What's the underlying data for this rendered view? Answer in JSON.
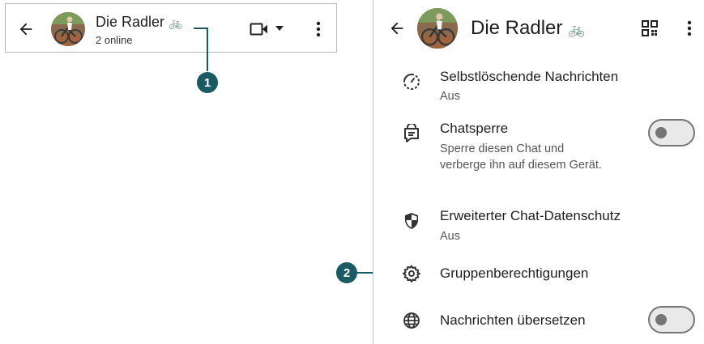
{
  "left_header": {
    "title": "Die Radler",
    "title_emoji": "🚲",
    "subtitle": "2 online",
    "icons": [
      "back-arrow-icon",
      "video-call-icon",
      "chevron-down-icon",
      "more-vertical-icon"
    ]
  },
  "right_panel": {
    "header": {
      "title": "Die Radler",
      "title_emoji": "🚲",
      "icons": [
        "back-arrow-icon",
        "qr-code-icon",
        "more-vertical-icon"
      ]
    },
    "settings": [
      {
        "icon": "disappearing-timer-icon",
        "title": "Selbstlöschende Nachrichten",
        "subtitle": "Aus"
      },
      {
        "icon": "chat-lock-icon",
        "title": "Chatsperre",
        "subtitle": "Sperre diesen Chat und verberge ihn auf diesem Gerät.",
        "toggle": false
      },
      {
        "icon": "shield-icon",
        "title": "Erweiterter Chat-Datenschutz",
        "subtitle": "Aus"
      },
      {
        "icon": "gear-icon",
        "title": "Gruppenberechtigungen"
      },
      {
        "icon": "globe-icon",
        "title": "Nachrichten übersetzen",
        "toggle": false
      }
    ]
  },
  "callouts": {
    "one": "1",
    "two": "2"
  },
  "colors": {
    "callout": "#1a5a62",
    "toggle_border": "#757575",
    "toggle_bg": "#e9e9e9"
  }
}
